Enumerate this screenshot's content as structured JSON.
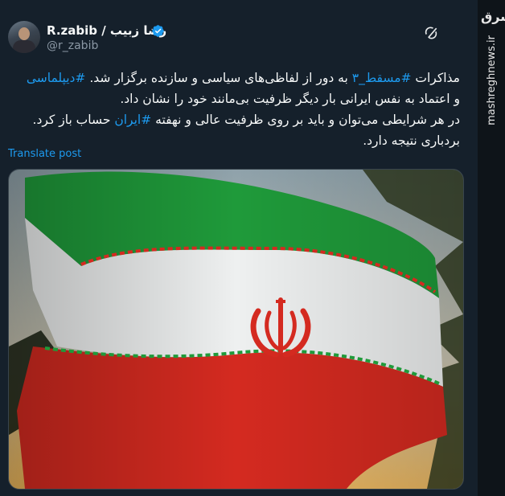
{
  "tweet": {
    "display_name": "R.zabib / رضا زبیب",
    "handle": "@r_zabib",
    "text_segments": [
      [
        {
          "t": "مذاکرات ",
          "h": false
        },
        {
          "t": "#مسقط_۳",
          "h": true
        },
        {
          "t": " به دور از لفاظی‌های سیاسی و سازنده برگزار شد. ",
          "h": false
        },
        {
          "t": "#دیپلماسی",
          "h": true
        }
      ],
      [
        {
          "t": "و اعتماد به نفس ایرانی بار دیگر ظرفیت بی‌مانند خود را نشان داد.",
          "h": false
        }
      ],
      [
        {
          "t": "در هر شرایطی می‌توان و باید بر روی ظرفیت عالی و نهفته ",
          "h": false
        },
        {
          "t": "#ایران",
          "h": true
        },
        {
          "t": " حساب باز کرد.",
          "h": false
        }
      ],
      [
        {
          "t": "بردباری نتیجه دارد.",
          "h": false
        }
      ]
    ],
    "translate_label": "Translate post"
  },
  "icons": {
    "verified": "verified-badge-icon",
    "grok": "grok-icon",
    "watermark": "mashregh-logo"
  },
  "watermark": {
    "logo_text": "مشرق",
    "url": "mashreghnews.ir"
  },
  "media": {
    "description_icon": "iran-flag-image"
  },
  "colors": {
    "background": "#15202b",
    "link": "#1d9bf0",
    "secondary": "#8b98a5",
    "flag_green": "#1f9a3a",
    "flag_red": "#d42a20"
  }
}
